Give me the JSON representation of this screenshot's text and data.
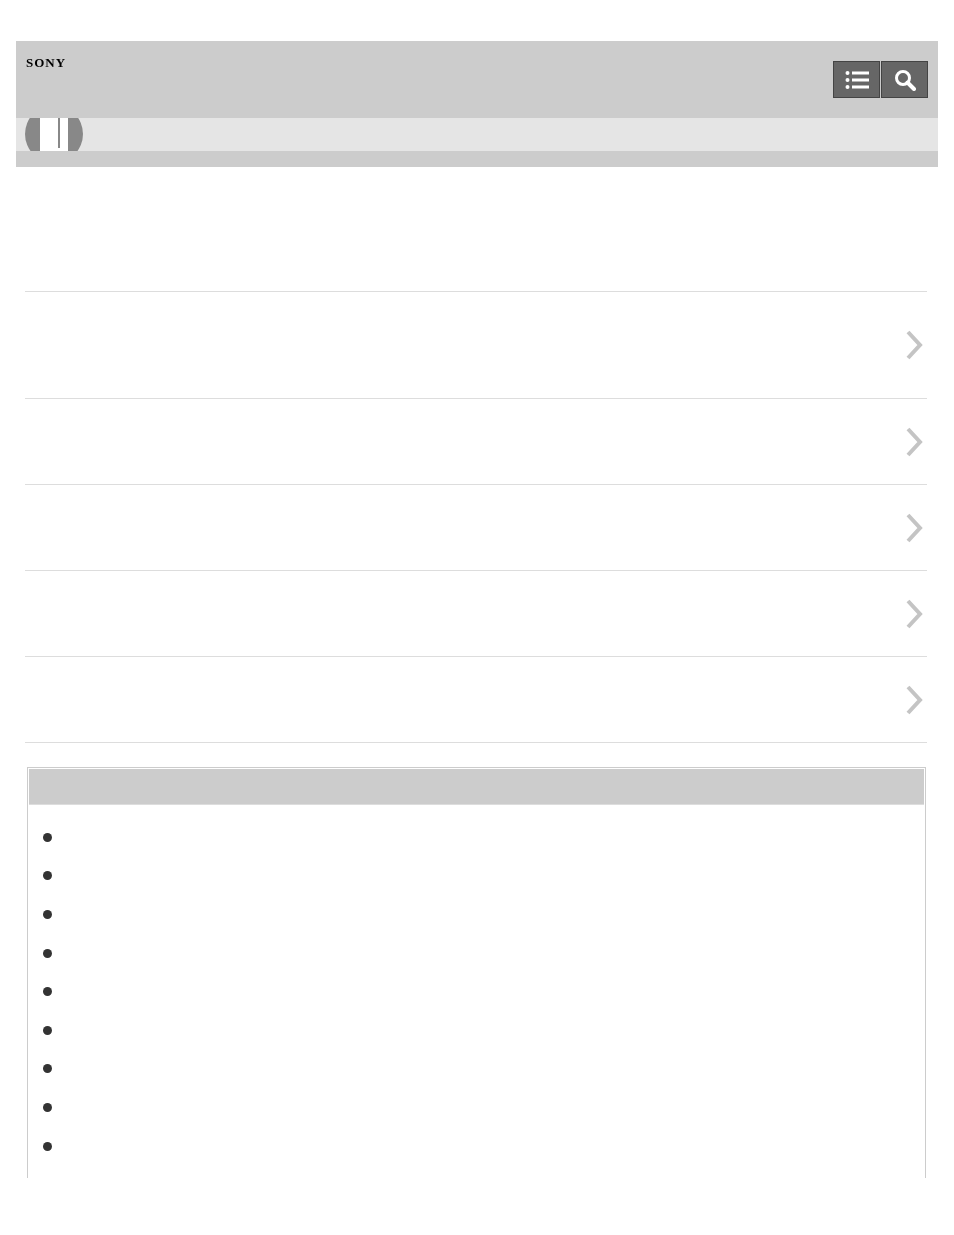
{
  "header": {
    "logo": "SONY"
  },
  "menu_rows": [
    {
      "kind": "link"
    },
    {
      "kind": "link"
    },
    {
      "kind": "link"
    },
    {
      "kind": "link"
    },
    {
      "kind": "link"
    }
  ],
  "related_box": {
    "items": [
      {
        "kind": "bullet"
      },
      {
        "kind": "bullet"
      },
      {
        "kind": "bullet"
      },
      {
        "kind": "bullet"
      },
      {
        "kind": "bullet"
      },
      {
        "kind": "bullet"
      },
      {
        "kind": "bullet"
      },
      {
        "kind": "bullet"
      },
      {
        "kind": "bullet"
      }
    ]
  }
}
